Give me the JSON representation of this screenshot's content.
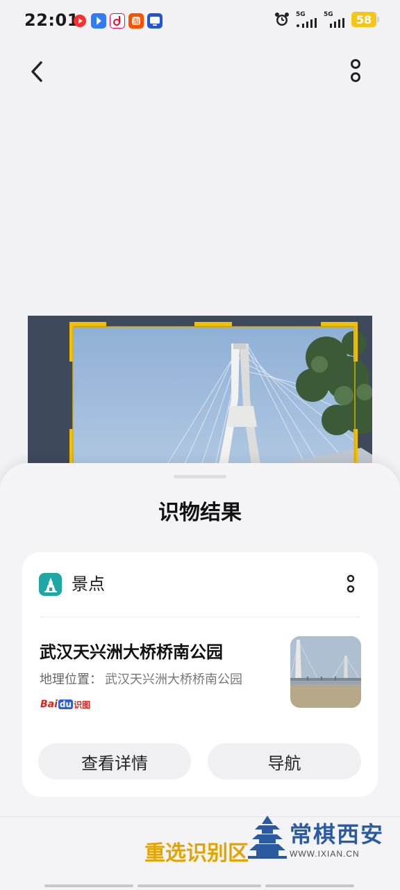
{
  "status_bar": {
    "time": "22:01",
    "network_1": "5G",
    "network_2": "5G",
    "battery": "58"
  },
  "sheet": {
    "title": "识物结果",
    "card": {
      "category": "景点",
      "place_name": "武汉天兴洲大桥桥南公园",
      "location_label": "地理位置：",
      "location_value": "武汉天兴洲大桥桥南公园",
      "source_logo": {
        "bai": "Bai",
        "du": "du",
        "text": "识图"
      },
      "buttons": {
        "details": "查看详情",
        "navigate": "导航"
      }
    },
    "reselect_label": "重选识别区"
  },
  "watermark": {
    "text": "常棋西安",
    "url": "WWW.IXIAN.CN"
  },
  "colors": {
    "accent": "#e3a400",
    "category_icon": "#1fa7a6",
    "battery": "#f5c518"
  },
  "icons": {
    "back": "chevron-left-icon",
    "more": "more-vertical-icon",
    "category": "landmark-tower-icon"
  }
}
